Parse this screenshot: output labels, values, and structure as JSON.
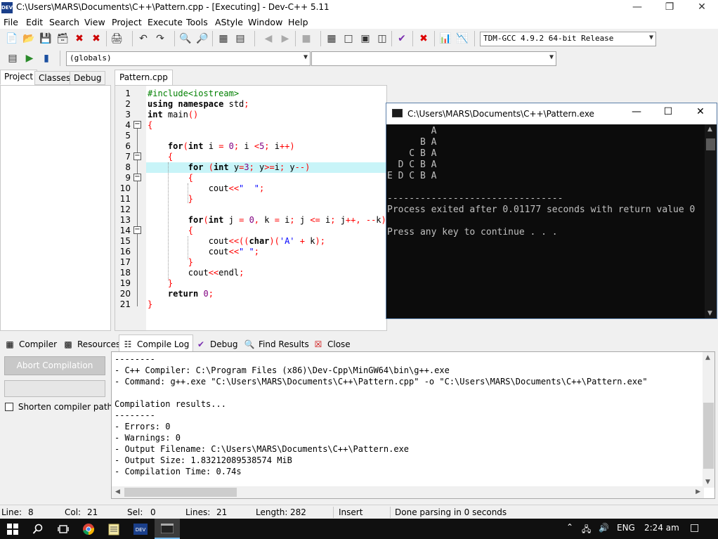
{
  "window": {
    "title": "C:\\Users\\MARS\\Documents\\C++\\Pattern.cpp - [Executing] - Dev-C++ 5.11",
    "app_icon": "DEV"
  },
  "menu": [
    "File",
    "Edit",
    "Search",
    "View",
    "Project",
    "Execute",
    "Tools",
    "AStyle",
    "Window",
    "Help"
  ],
  "toolbar": {
    "compiler_select": "TDM-GCC 4.9.2 64-bit Release",
    "globals_select": "(globals)",
    "member_select": ""
  },
  "left_tabs": [
    "Project",
    "Classes",
    "Debug"
  ],
  "editor": {
    "tab": "Pattern.cpp",
    "line_numbers": [
      "1",
      "2",
      "3",
      "4",
      "5",
      "6",
      "7",
      "8",
      "9",
      "10",
      "11",
      "12",
      "13",
      "14",
      "15",
      "16",
      "17",
      "18",
      "19",
      "20",
      "21"
    ],
    "highlight_line": 8
  },
  "console": {
    "title": "C:\\Users\\MARS\\Documents\\C++\\Pattern.exe",
    "lines": [
      "        A",
      "      B A",
      "    C B A",
      "  D C B A",
      "E D C B A",
      "",
      "--------------------------------",
      "Process exited after 0.01177 seconds with return value 0",
      "",
      "Press any key to continue . . ."
    ]
  },
  "bottom_tabs": [
    "Compiler",
    "Resources",
    "Compile Log",
    "Debug",
    "Find Results",
    "Close"
  ],
  "compile_panel": {
    "abort_label": "Abort Compilation",
    "shorten_label": "Shorten compiler paths",
    "log_lines": [
      "--------",
      "- C++ Compiler: C:\\Program Files (x86)\\Dev-Cpp\\MinGW64\\bin\\g++.exe",
      "- Command: g++.exe \"C:\\Users\\MARS\\Documents\\C++\\Pattern.cpp\" -o \"C:\\Users\\MARS\\Documents\\C++\\Pattern.exe\"",
      "",
      "Compilation results...",
      "--------",
      "- Errors: 0",
      "- Warnings: 0",
      "- Output Filename: C:\\Users\\MARS\\Documents\\C++\\Pattern.exe",
      "- Output Size: 1.83212089538574 MiB",
      "- Compilation Time: 0.74s"
    ]
  },
  "status": {
    "line_label": "Line:",
    "line_value": "8",
    "col_label": "Col:",
    "col_value": "21",
    "sel_label": "Sel:",
    "sel_value": "0",
    "lines_label": "Lines:",
    "lines_value": "21",
    "length_label": "Length:",
    "length_value": "282",
    "mode": "Insert",
    "message": "Done parsing in 0 seconds"
  },
  "taskbar": {
    "language": "ENG",
    "time": "2:24 am"
  }
}
